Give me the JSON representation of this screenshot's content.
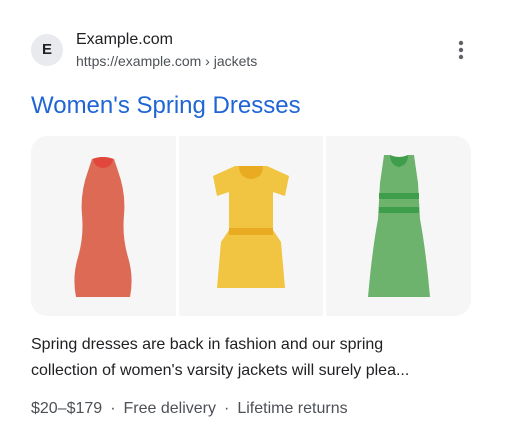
{
  "site": {
    "favicon_letter": "E",
    "name": "Example.com",
    "url": "https://example.com › jackets"
  },
  "menu": {
    "icon": "more-vertical-icon"
  },
  "result": {
    "title": "Women's Spring Dresses",
    "snippet_line1": "Spring dresses are back in fashion and our spring",
    "snippet_line2": "collection of women's varsity jackets will surely plea..."
  },
  "gallery": {
    "images": [
      {
        "icon": "red-dress-icon",
        "color": "#dc6a55",
        "accent": "#e1473a"
      },
      {
        "icon": "yellow-dress-icon",
        "color": "#f1c441",
        "accent": "#e9ab22"
      },
      {
        "icon": "green-dress-icon",
        "color": "#6db36e",
        "accent": "#3e9e4b"
      }
    ]
  },
  "meta": {
    "price": "$20–$179",
    "separator": "·",
    "delivery": "Free delivery",
    "returns": "Lifetime returns"
  },
  "colors": {
    "title_link": "#1f65d6",
    "text": "#202124",
    "secondary_text": "#4d5156",
    "gallery_bg": "#f6f6f6"
  }
}
